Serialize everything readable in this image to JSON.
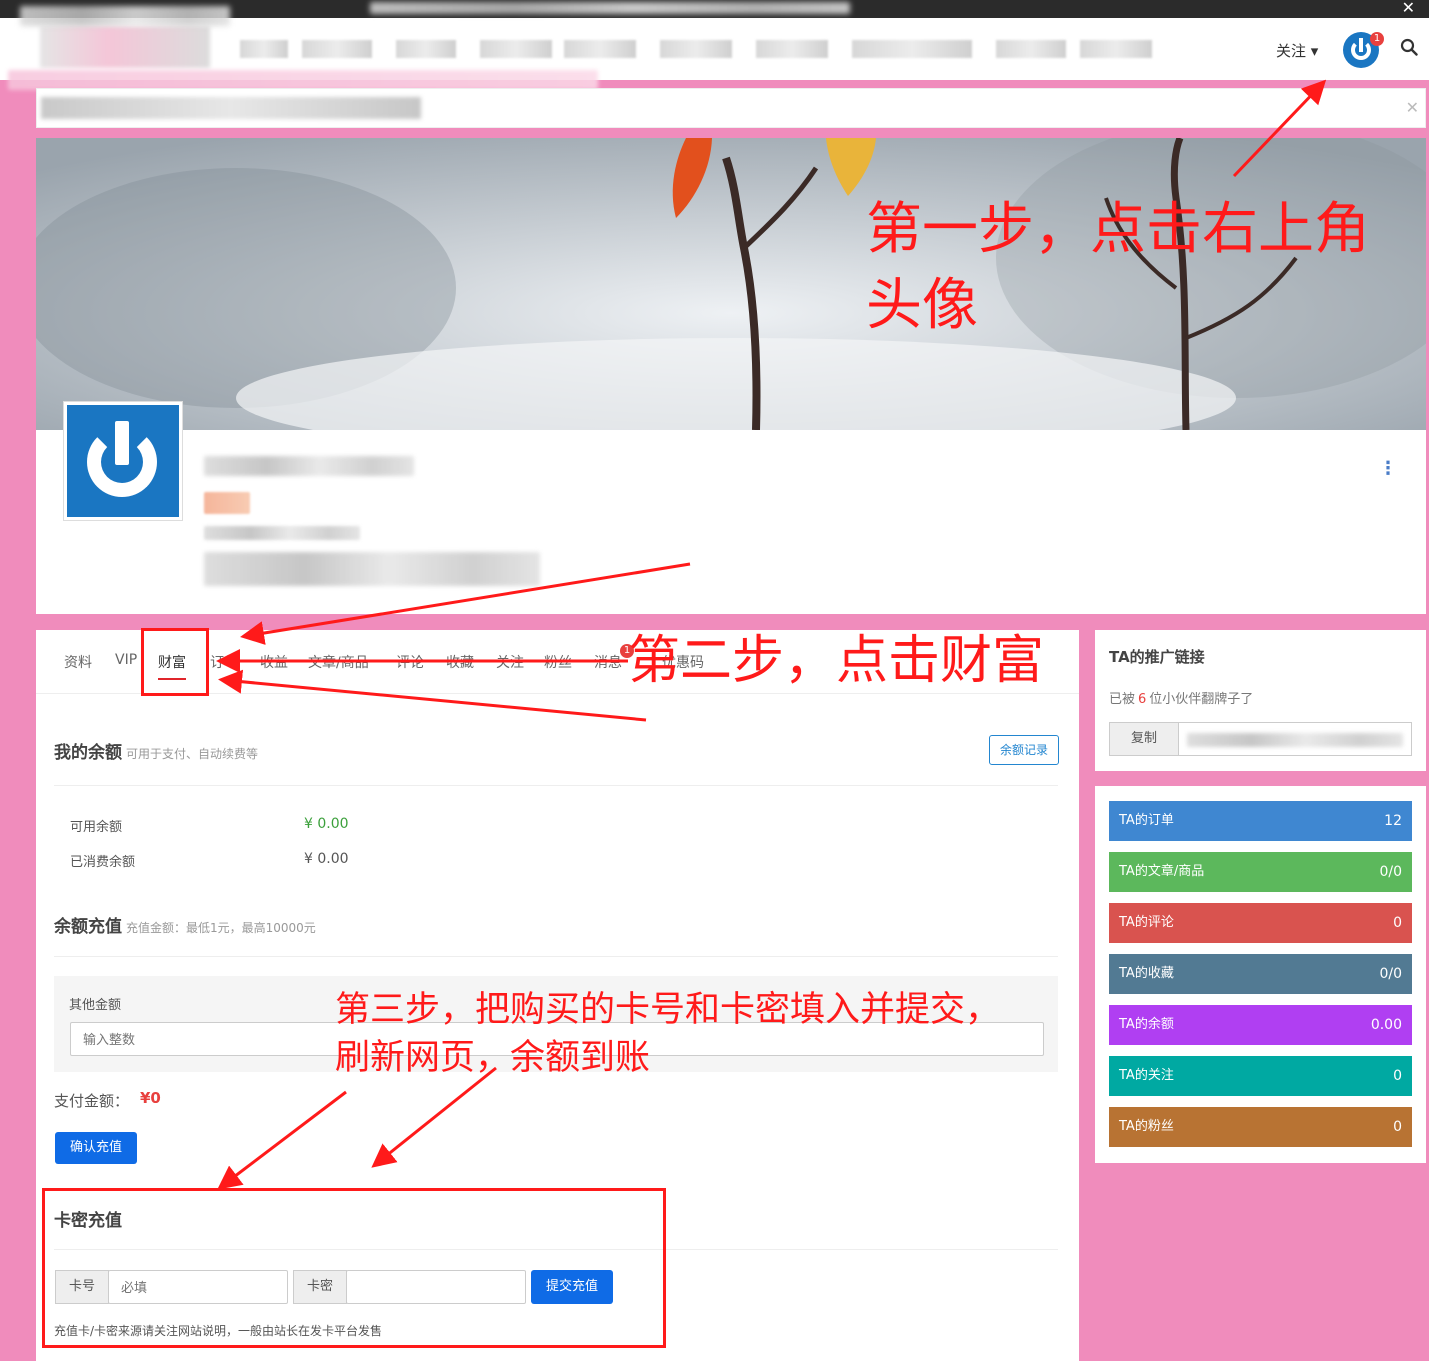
{
  "navbar": {
    "follow_label": "关注 ▾",
    "badge": "1"
  },
  "tabs": [
    {
      "label": "资料"
    },
    {
      "label": "VIP"
    },
    {
      "label": "财富"
    },
    {
      "label": "订单"
    },
    {
      "label": "收益"
    },
    {
      "label": "文章/商品"
    },
    {
      "label": "评论"
    },
    {
      "label": "收藏"
    },
    {
      "label": "关注"
    },
    {
      "label": "粉丝"
    },
    {
      "label": "消息"
    },
    {
      "label": "优惠码"
    }
  ],
  "tab_badge": "1",
  "balance": {
    "title": "我的余额",
    "subtitle": "可用于支付、自动续费等",
    "records_button": "余额记录",
    "available_label": "可用余额",
    "available_value": "¥ 0.00",
    "consumed_label": "已消费余额",
    "consumed_value": "¥ 0.00"
  },
  "recharge": {
    "title": "余额充值",
    "subtitle": "充值金额：最低1元，最高10000元",
    "other_label": "其他金额",
    "input_placeholder": "输入整数",
    "pay_label": "支付金额：",
    "pay_value": "¥0",
    "confirm_button": "确认充值"
  },
  "card_recharge": {
    "title": "卡密充值",
    "card_no_label": "卡号",
    "card_no_placeholder": "必填",
    "card_pwd_label": "卡密",
    "submit_button": "提交充值",
    "hint": "充值卡/卡密来源请关注网站说明，一般由站长在发卡平台发售"
  },
  "promo": {
    "title": "TA的推广链接",
    "text_pre": "已被",
    "count": "6",
    "text_post": "位小伙伴翻牌子了",
    "copy_button": "复制"
  },
  "stats": [
    {
      "label": "TA的订单",
      "value": "12",
      "color": "#3f87d1"
    },
    {
      "label": "TA的文章/商品",
      "value": "0/0",
      "color": "#5cb85c"
    },
    {
      "label": "TA的评论",
      "value": "0",
      "color": "#d9534f"
    },
    {
      "label": "TA的收藏",
      "value": "0/0",
      "color": "#527a93"
    },
    {
      "label": "TA的余额",
      "value": "0.00",
      "color": "#b03ff2"
    },
    {
      "label": "TA的关注",
      "value": "0",
      "color": "#00a9a2"
    },
    {
      "label": "TA的粉丝",
      "value": "0",
      "color": "#b87333"
    }
  ],
  "annotations": {
    "step1_line1": "第一步，点击右上角",
    "step1_line2": "头像",
    "step2": "第二步，点击财富",
    "step3_line1": "第三步，把购买的卡号和卡密填入并提交，",
    "step3_line2": "刷新网页，余额到账"
  }
}
